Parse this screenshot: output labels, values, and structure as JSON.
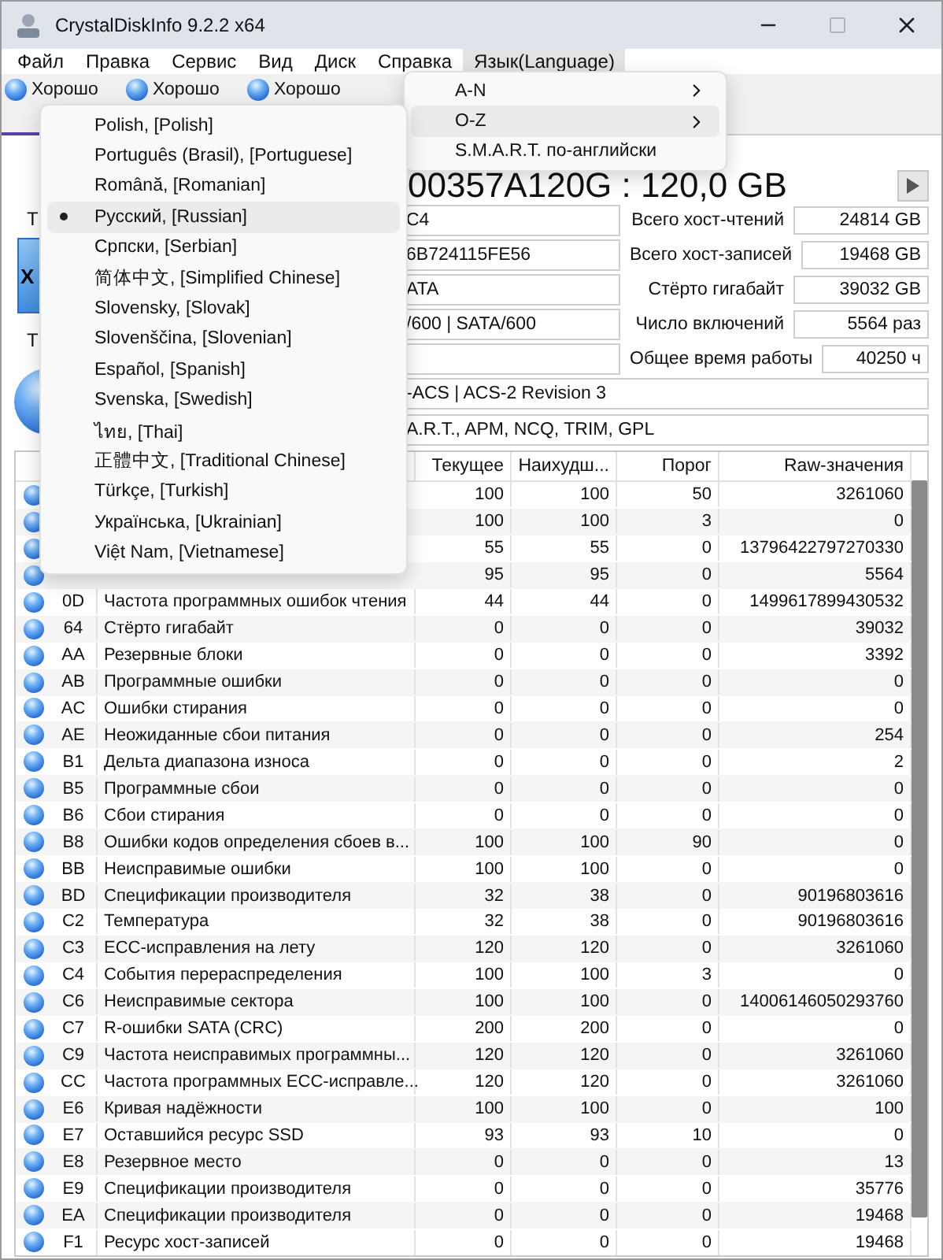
{
  "window": {
    "title": "CrystalDiskInfo 9.2.2 x64"
  },
  "menu_bar": [
    {
      "label": "Файл",
      "open": false
    },
    {
      "label": "Правка",
      "open": false
    },
    {
      "label": "Сервис",
      "open": false
    },
    {
      "label": "Вид",
      "open": false
    },
    {
      "label": "Диск",
      "open": false
    },
    {
      "label": "Справка",
      "open": false
    },
    {
      "label": "Язык(Language)",
      "open": true
    }
  ],
  "disks": [
    {
      "status": "Хорошо"
    },
    {
      "status": "Хорошо"
    },
    {
      "status": "Хорошо"
    }
  ],
  "model_title": "00357A120G : 120,0 GB",
  "left_panel": {
    "health_label": "Т",
    "health_value": "Х",
    "temperature_label": "Т"
  },
  "info_fields": [
    {
      "value": "C4"
    },
    {
      "value": "6B724115FE56"
    },
    {
      "value": "ATA"
    },
    {
      "value": "/600 | SATA/600"
    }
  ],
  "stats": [
    {
      "label": "Всего хост-чтений",
      "value": "24814 GB"
    },
    {
      "label": "Всего хост-записей",
      "value": "19468 GB"
    },
    {
      "label": "Стёрто гигабайт",
      "value": "39032 GB"
    },
    {
      "label": "Число включений",
      "value": "5564 раз"
    },
    {
      "label": "Общее время работы",
      "value": "40250 ч"
    }
  ],
  "standard": "-ACS | ACS-2 Revision 3",
  "features": "A.R.T., APM, NCQ, TRIM, GPL",
  "table": {
    "columns": [
      "Текущее",
      "Наихудш...",
      "Порог",
      "Raw-значения"
    ],
    "rows": [
      {
        "current": "100",
        "worst": "100",
        "threshold": "50",
        "raw": "3261060"
      },
      {
        "current": "100",
        "worst": "100",
        "threshold": "3",
        "raw": "0"
      },
      {
        "current": "55",
        "worst": "55",
        "threshold": "0",
        "raw": "13796422797270330"
      },
      {
        "current": "95",
        "worst": "95",
        "threshold": "0",
        "raw": "5564"
      },
      {
        "id": "0D",
        "name": "Частота программных ошибок чтения",
        "current": "44",
        "worst": "44",
        "threshold": "0",
        "raw": "1499617899430532"
      },
      {
        "id": "64",
        "name": "Стёрто гигабайт",
        "current": "0",
        "worst": "0",
        "threshold": "0",
        "raw": "39032"
      },
      {
        "id": "AA",
        "name": "Резервные блоки",
        "current": "0",
        "worst": "0",
        "threshold": "0",
        "raw": "3392"
      },
      {
        "id": "AB",
        "name": "Программные ошибки",
        "current": "0",
        "worst": "0",
        "threshold": "0",
        "raw": "0"
      },
      {
        "id": "AC",
        "name": "Ошибки стирания",
        "current": "0",
        "worst": "0",
        "threshold": "0",
        "raw": "0"
      },
      {
        "id": "AE",
        "name": "Неожиданные сбои питания",
        "current": "0",
        "worst": "0",
        "threshold": "0",
        "raw": "254"
      },
      {
        "id": "B1",
        "name": "Дельта диапазона износа",
        "current": "0",
        "worst": "0",
        "threshold": "0",
        "raw": "2"
      },
      {
        "id": "B5",
        "name": "Программные сбои",
        "current": "0",
        "worst": "0",
        "threshold": "0",
        "raw": "0"
      },
      {
        "id": "B6",
        "name": "Сбои стирания",
        "current": "0",
        "worst": "0",
        "threshold": "0",
        "raw": "0"
      },
      {
        "id": "B8",
        "name": "Ошибки кодов определения сбоев в...",
        "current": "100",
        "worst": "100",
        "threshold": "90",
        "raw": "0"
      },
      {
        "id": "BB",
        "name": "Неисправимые ошибки",
        "current": "100",
        "worst": "100",
        "threshold": "0",
        "raw": "0"
      },
      {
        "id": "BD",
        "name": "Спецификации производителя",
        "current": "32",
        "worst": "38",
        "threshold": "0",
        "raw": "90196803616"
      },
      {
        "id": "C2",
        "name": "Температура",
        "current": "32",
        "worst": "38",
        "threshold": "0",
        "raw": "90196803616"
      },
      {
        "id": "C3",
        "name": "ECC-исправления на лету",
        "current": "120",
        "worst": "120",
        "threshold": "0",
        "raw": "3261060"
      },
      {
        "id": "C4",
        "name": "События перераспределения",
        "current": "100",
        "worst": "100",
        "threshold": "3",
        "raw": "0"
      },
      {
        "id": "C6",
        "name": "Неисправимые сектора",
        "current": "100",
        "worst": "100",
        "threshold": "0",
        "raw": "14006146050293760"
      },
      {
        "id": "C7",
        "name": "R-ошибки SATA (CRC)",
        "current": "200",
        "worst": "200",
        "threshold": "0",
        "raw": "0"
      },
      {
        "id": "C9",
        "name": "Частота неисправимых программны...",
        "current": "120",
        "worst": "120",
        "threshold": "0",
        "raw": "3261060"
      },
      {
        "id": "CC",
        "name": "Частота программных ECC-исправле...",
        "current": "120",
        "worst": "120",
        "threshold": "0",
        "raw": "3261060"
      },
      {
        "id": "E6",
        "name": "Кривая надёжности",
        "current": "100",
        "worst": "100",
        "threshold": "0",
        "raw": "100"
      },
      {
        "id": "E7",
        "name": "Оставшийся ресурс SSD",
        "current": "93",
        "worst": "93",
        "threshold": "10",
        "raw": "0"
      },
      {
        "id": "E8",
        "name": "Резервное место",
        "current": "0",
        "worst": "0",
        "threshold": "0",
        "raw": "13"
      },
      {
        "id": "E9",
        "name": "Спецификации производителя",
        "current": "0",
        "worst": "0",
        "threshold": "0",
        "raw": "35776"
      },
      {
        "id": "EA",
        "name": "Спецификации производителя",
        "current": "0",
        "worst": "0",
        "threshold": "0",
        "raw": "19468"
      },
      {
        "id": "F1",
        "name": "Ресурс хост-записей",
        "current": "0",
        "worst": "0",
        "threshold": "0",
        "raw": "19468"
      }
    ]
  },
  "language_menu": {
    "items": [
      {
        "label": "A-N",
        "submenu": true,
        "selected": false
      },
      {
        "label": "O-Z",
        "submenu": true,
        "selected": true
      },
      {
        "label": "S.M.A.R.T. по-английски",
        "submenu": false,
        "selected": false
      }
    ]
  },
  "language_submenu": {
    "items": [
      {
        "label": "Polish, [Polish]",
        "checked": false,
        "selected": false
      },
      {
        "label": "Português (Brasil), [Portuguese]",
        "checked": false,
        "selected": false
      },
      {
        "label": "Română, [Romanian]",
        "checked": false,
        "selected": false
      },
      {
        "label": "Русский, [Russian]",
        "checked": true,
        "selected": true
      },
      {
        "label": "Српски, [Serbian]",
        "checked": false,
        "selected": false
      },
      {
        "label": "简体中文, [Simplified Chinese]",
        "checked": false,
        "selected": false
      },
      {
        "label": "Slovensky, [Slovak]",
        "checked": false,
        "selected": false
      },
      {
        "label": "Slovenščina, [Slovenian]",
        "checked": false,
        "selected": false
      },
      {
        "label": "Español, [Spanish]",
        "checked": false,
        "selected": false
      },
      {
        "label": "Svenska, [Swedish]",
        "checked": false,
        "selected": false
      },
      {
        "label": "ไทย, [Thai]",
        "checked": false,
        "selected": false
      },
      {
        "label": "正體中文, [Traditional Chinese]",
        "checked": false,
        "selected": false
      },
      {
        "label": "Türkçe, [Turkish]",
        "checked": false,
        "selected": false
      },
      {
        "label": "Українська, [Ukrainian]",
        "checked": false,
        "selected": false
      },
      {
        "label": "Việt Nam, [Vietnamese]",
        "checked": false,
        "selected": false
      }
    ]
  }
}
